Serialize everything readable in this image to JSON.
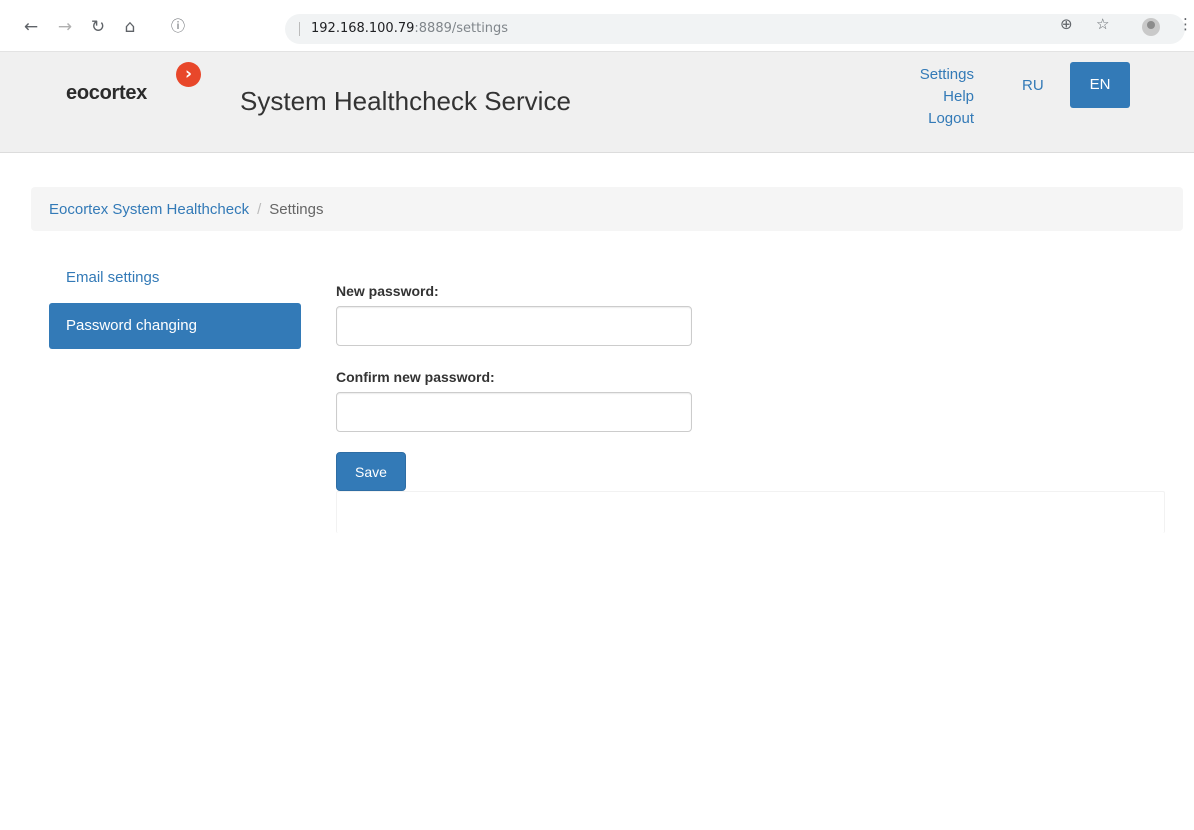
{
  "browser": {
    "back_icon": "arrow-left-icon",
    "forward_icon": "arrow-right-icon",
    "reload_icon": "reload-icon",
    "home_icon": "home-icon",
    "info_icon": "info-icon",
    "url_host": "192.168.100.79",
    "url_rest": ":8889/settings",
    "zoom_icon": "zoom-icon",
    "bookmark_icon": "star-icon",
    "profile_icon": "profile-icon",
    "menu_icon": "kebab-menu-icon"
  },
  "header": {
    "logo_text": "eocortex",
    "logo_badge_icon": "chevron-right-icon",
    "title": "System Healthcheck Service",
    "links": [
      "Settings",
      "Help",
      "Logout"
    ],
    "lang_ru": "RU",
    "lang_en": "EN",
    "active_lang": "EN"
  },
  "breadcrumb": {
    "home": "Eocortex System Healthcheck",
    "separator": "/",
    "current": "Settings"
  },
  "sidebar": {
    "items": [
      {
        "label": "Email settings",
        "active": false
      },
      {
        "label": "Password changing",
        "active": true
      }
    ]
  },
  "form": {
    "new_password_label": "New password:",
    "new_password_value": "",
    "confirm_password_label": "Confirm new password:",
    "confirm_password_value": "",
    "save_label": "Save"
  },
  "colors": {
    "primary": "#337ab7",
    "header_bg": "#f0f0f0",
    "logo_accent": "#e8472a"
  }
}
